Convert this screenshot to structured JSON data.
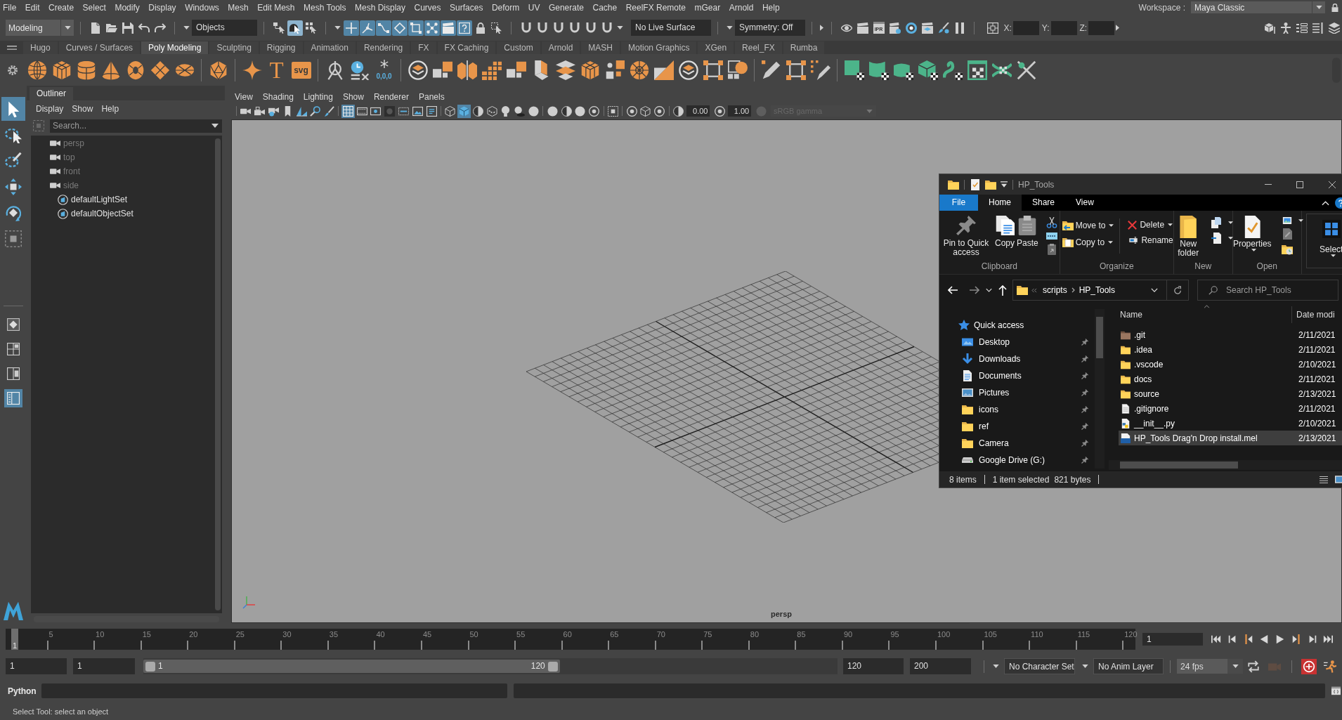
{
  "menu_bar": {
    "items": [
      "File",
      "Edit",
      "Create",
      "Select",
      "Modify",
      "Display",
      "Windows",
      "Mesh",
      "Edit Mesh",
      "Mesh Tools",
      "Mesh Display",
      "Curves",
      "Surfaces",
      "Deform",
      "UV",
      "Generate",
      "Cache",
      "ReelFX Remote",
      "mGear",
      "Arnold",
      "Help"
    ],
    "workspace_label": "Workspace :",
    "workspace": "Maya Classic"
  },
  "status_line": {
    "menu_set": "Modeling",
    "select_modes": [
      {
        "selected": false
      },
      {
        "selected": true
      },
      {
        "selected": false
      }
    ],
    "selection_mask": "Objects",
    "pick_masks": [
      {
        "on": true
      },
      {
        "on": true
      },
      {
        "on": true
      },
      {
        "on": true
      },
      {
        "on": true
      },
      {
        "on": true
      },
      {
        "on": true
      },
      {
        "on": true
      }
    ],
    "snaps": [
      {
        "on": false
      },
      {
        "on": false
      },
      {
        "on": false
      },
      {
        "on": false
      },
      {
        "on": false
      },
      {
        "on": false
      }
    ],
    "live_surface": "No Live Surface",
    "symmetry": "Symmetry: Off",
    "ipr": "IPR",
    "coordinates": [
      "X:",
      "Y:",
      "Z:"
    ]
  },
  "shelf": {
    "tabs": [
      {
        "label": "Hugo",
        "selected": false
      },
      {
        "label": "Curves / Surfaces",
        "selected": false
      },
      {
        "label": "Poly Modeling",
        "selected": true
      },
      {
        "label": "Sculpting",
        "selected": false
      },
      {
        "label": "Rigging",
        "selected": false
      },
      {
        "label": "Animation",
        "selected": false
      },
      {
        "label": "Rendering",
        "selected": false
      },
      {
        "label": "FX",
        "selected": false
      },
      {
        "label": "FX Caching",
        "selected": false
      },
      {
        "label": "Custom",
        "selected": false
      },
      {
        "label": "Arnold",
        "selected": false
      },
      {
        "label": "MASH",
        "selected": false
      },
      {
        "label": "Motion Graphics",
        "selected": false
      },
      {
        "label": "XGen",
        "selected": false
      },
      {
        "label": "Reel_FX",
        "selected": false
      },
      {
        "label": "Rumba",
        "selected": false
      }
    ],
    "text_tool": "T",
    "svg_tool": "svg",
    "freeze_label": "0,0,0"
  },
  "toolbox": {
    "tools": [
      {
        "selected": true
      },
      {
        "selected": false
      },
      {
        "selected": false
      },
      {
        "selected": false
      },
      {
        "selected": false
      },
      {
        "selected": false
      }
    ],
    "layouts": [
      {
        "selected": false
      },
      {
        "selected": false
      },
      {
        "selected": false
      },
      {
        "selected": true
      }
    ]
  },
  "outliner": {
    "title": "Outliner",
    "menu": [
      "Display",
      "Show",
      "Help"
    ],
    "search_placeholder": "Search...",
    "items": [
      {
        "label": "persp",
        "kind": "camera",
        "hidden": true
      },
      {
        "label": "top",
        "kind": "camera",
        "hidden": true
      },
      {
        "label": "front",
        "kind": "camera",
        "hidden": true
      },
      {
        "label": "side",
        "kind": "camera",
        "hidden": true
      },
      {
        "label": "defaultLightSet",
        "kind": "set",
        "hidden": false
      },
      {
        "label": "defaultObjectSet",
        "kind": "set",
        "hidden": false
      }
    ]
  },
  "viewport": {
    "menu": [
      "View",
      "Shading",
      "Lighting",
      "Show",
      "Renderer",
      "Panels"
    ],
    "toggles": [
      {
        "on": false
      },
      {
        "on": false
      },
      {
        "on": false
      },
      {
        "on": false
      },
      {
        "on": false
      },
      {
        "on": false
      },
      {
        "on": false
      },
      {
        "on": true
      },
      {
        "on": false
      },
      {
        "on": false
      },
      {
        "on": false
      },
      {
        "on": false
      },
      {
        "on": false
      },
      {
        "on": false
      },
      {
        "on": false
      },
      {
        "on": true
      },
      {
        "on": false
      },
      {
        "on": false
      },
      {
        "on": false
      },
      {
        "on": false
      },
      {
        "on": false
      },
      {
        "on": false
      },
      {
        "on": false
      },
      {
        "on": false
      },
      {
        "on": false
      },
      {
        "on": false
      },
      {
        "on": false
      },
      {
        "on": false
      },
      {
        "on": false
      }
    ],
    "exposure": "0.00",
    "gamma": "1.00",
    "color_space": {
      "label": "sRGB gamma",
      "disabled": true
    },
    "camera": "persp"
  },
  "explorer": {
    "title": "HP_Tools",
    "file_tab": "File",
    "tabs": [
      {
        "label": "Home",
        "selected": true
      },
      {
        "label": "Share",
        "selected": false
      },
      {
        "label": "View",
        "selected": false
      }
    ],
    "ribbon": {
      "clipboard": {
        "label": "Clipboard",
        "pin": "Pin to Quick access",
        "copy": "Copy",
        "paste": "Paste"
      },
      "organize": {
        "label": "Organize",
        "move_to": "Move to",
        "copy_to": "Copy to",
        "delete": "Delete",
        "rename": "Rename"
      },
      "new": {
        "label": "New",
        "new_folder": "New folder"
      },
      "open": {
        "label": "Open",
        "properties": "Properties"
      },
      "select": {
        "button": "Select"
      }
    },
    "path": [
      "scripts",
      "HP_Tools"
    ],
    "search_placeholder": "Search HP_Tools",
    "nav": [
      {
        "label": "Quick access",
        "kind": "quick_access",
        "pinned": false
      },
      {
        "label": "Desktop",
        "kind": "desktop",
        "pinned": true
      },
      {
        "label": "Downloads",
        "kind": "downloads",
        "pinned": true
      },
      {
        "label": "Documents",
        "kind": "documents",
        "pinned": true
      },
      {
        "label": "Pictures",
        "kind": "pictures",
        "pinned": true
      },
      {
        "label": "icons",
        "kind": "folder",
        "pinned": true
      },
      {
        "label": "ref",
        "kind": "folder",
        "pinned": true
      },
      {
        "label": "Camera",
        "kind": "folder",
        "pinned": true
      },
      {
        "label": "Google Drive (G:)",
        "kind": "drive",
        "pinned": true
      }
    ],
    "columns": [
      "Name",
      "Date modi"
    ],
    "files": [
      {
        "name": ".git",
        "date": "2/11/2021",
        "kind": "repo_folder",
        "selected": false
      },
      {
        "name": ".idea",
        "date": "2/11/2021",
        "kind": "folder",
        "selected": false
      },
      {
        "name": ".vscode",
        "date": "2/10/2021",
        "kind": "folder",
        "selected": false
      },
      {
        "name": "docs",
        "date": "2/11/2021",
        "kind": "folder",
        "selected": false
      },
      {
        "name": "source",
        "date": "2/13/2021",
        "kind": "folder",
        "selected": false
      },
      {
        "name": ".gitignore",
        "date": "2/11/2021",
        "kind": "file",
        "selected": false
      },
      {
        "name": "__init__.py",
        "date": "2/10/2021",
        "kind": "python",
        "selected": false
      },
      {
        "name": "HP_Tools Drag'n Drop install.mel",
        "date": "2/13/2021",
        "kind": "script",
        "selected": true
      }
    ],
    "status": {
      "count": "8 items",
      "selection": "1 item selected",
      "size": "821 bytes"
    }
  },
  "time_slider": {
    "ticks": [
      "5",
      "10",
      "15",
      "20",
      "25",
      "30",
      "35",
      "40",
      "45",
      "50",
      "55",
      "60",
      "65",
      "70",
      "75",
      "80",
      "85",
      "90",
      "95",
      "100",
      "105",
      "110",
      "115",
      "120"
    ],
    "current_frame": "1",
    "level": 0.005,
    "frame_field": "1"
  },
  "range_slider": {
    "start": "1",
    "playback_start": "1",
    "range_start": "1",
    "range_end": "120",
    "level": 0.6,
    "playback_end": "120",
    "end": "200",
    "character_set": "No Character Set",
    "anim_layer": "No Anim Layer",
    "fps": "24 fps",
    "auto_key": true
  },
  "command_line": {
    "language": "Python"
  },
  "help_line": "Select Tool: select an object"
}
